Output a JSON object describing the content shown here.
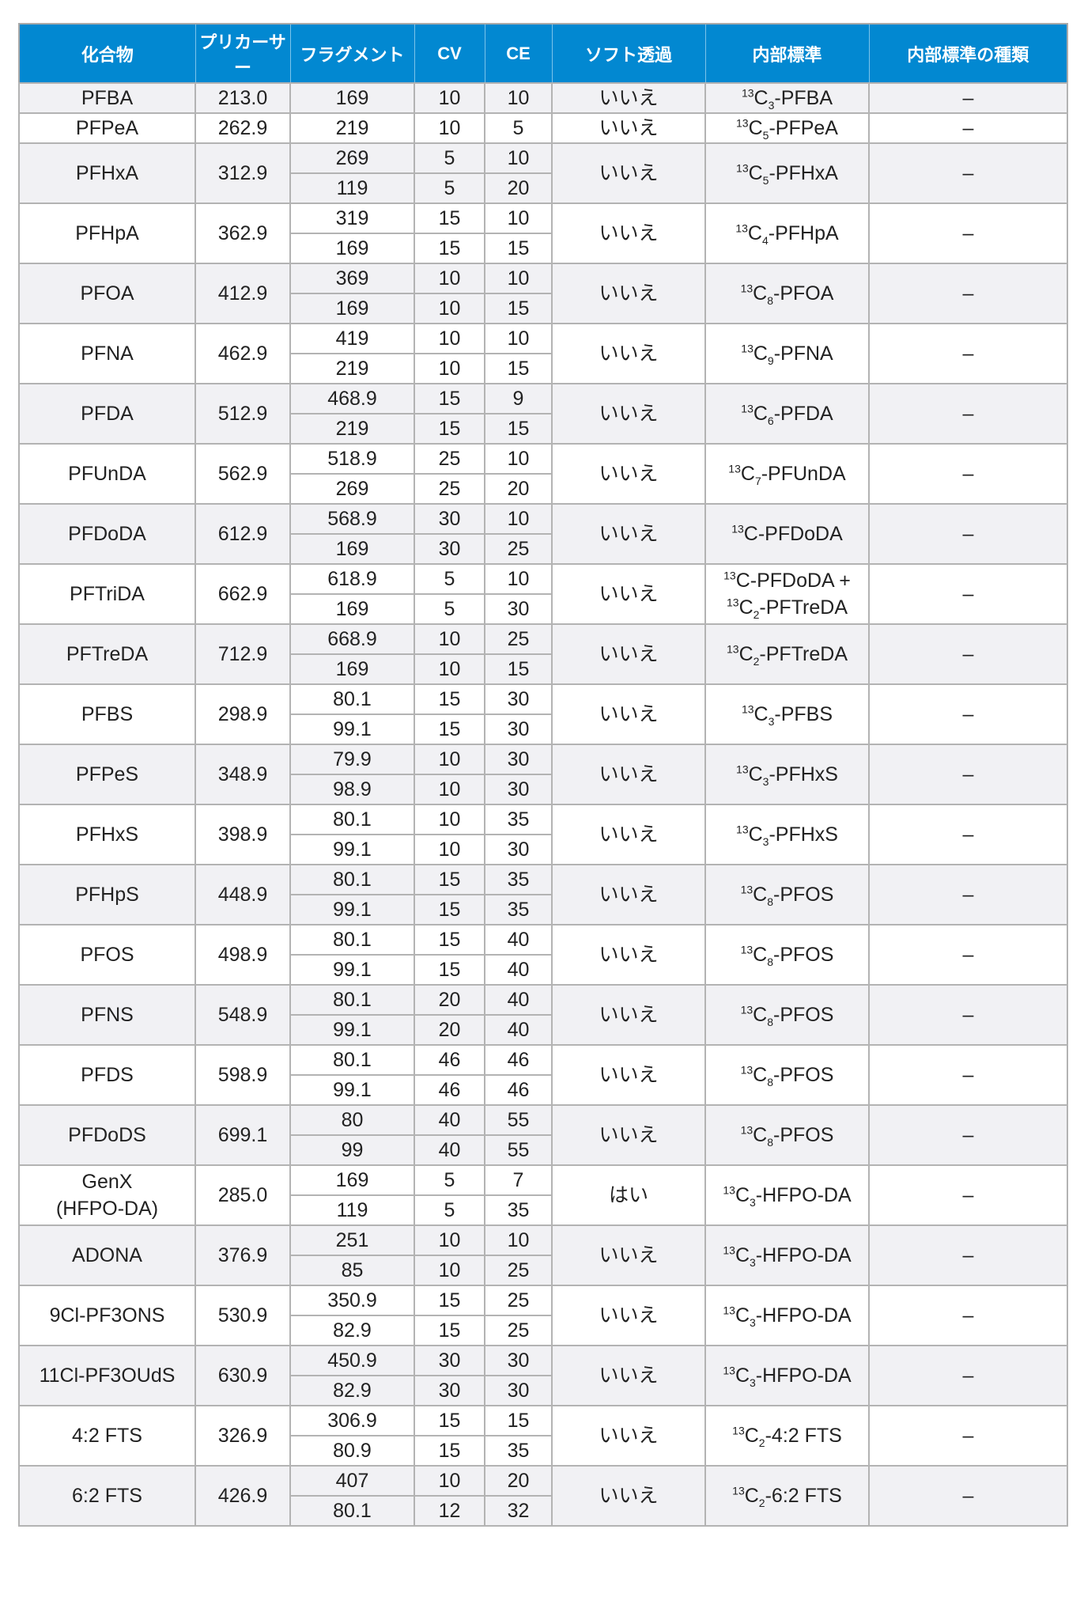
{
  "headers": [
    "化合物",
    "プリカーサー",
    "フラグメント",
    "CV",
    "CE",
    "ソフト透過",
    "内部標準",
    "内部標準の種類"
  ],
  "rows": [
    {
      "compound": "PFBA",
      "precursor": "213.0",
      "transitions": [
        {
          "fragment": "169",
          "cv": "10",
          "ce": "10"
        }
      ],
      "soft": "いいえ",
      "is": [
        {
          "iso": "13",
          "el": "C",
          "n": "3",
          "name": "-PFBA"
        }
      ],
      "is_type": "–"
    },
    {
      "compound": "PFPeA",
      "precursor": "262.9",
      "transitions": [
        {
          "fragment": "219",
          "cv": "10",
          "ce": "5"
        }
      ],
      "soft": "いいえ",
      "is": [
        {
          "iso": "13",
          "el": "C",
          "n": "5",
          "name": "-PFPeA"
        }
      ],
      "is_type": "–"
    },
    {
      "compound": "PFHxA",
      "precursor": "312.9",
      "transitions": [
        {
          "fragment": "269",
          "cv": "5",
          "ce": "10"
        },
        {
          "fragment": "119",
          "cv": "5",
          "ce": "20"
        }
      ],
      "soft": "いいえ",
      "is": [
        {
          "iso": "13",
          "el": "C",
          "n": "5",
          "name": "-PFHxA"
        }
      ],
      "is_type": "–"
    },
    {
      "compound": "PFHpA",
      "precursor": "362.9",
      "transitions": [
        {
          "fragment": "319",
          "cv": "15",
          "ce": "10"
        },
        {
          "fragment": "169",
          "cv": "15",
          "ce": "15"
        }
      ],
      "soft": "いいえ",
      "is": [
        {
          "iso": "13",
          "el": "C",
          "n": "4",
          "name": "-PFHpA"
        }
      ],
      "is_type": "–"
    },
    {
      "compound": "PFOA",
      "precursor": "412.9",
      "transitions": [
        {
          "fragment": "369",
          "cv": "10",
          "ce": "10"
        },
        {
          "fragment": "169",
          "cv": "10",
          "ce": "15"
        }
      ],
      "soft": "いいえ",
      "is": [
        {
          "iso": "13",
          "el": "C",
          "n": "8",
          "name": "-PFOA"
        }
      ],
      "is_type": "–"
    },
    {
      "compound": "PFNA",
      "precursor": "462.9",
      "transitions": [
        {
          "fragment": "419",
          "cv": "10",
          "ce": "10"
        },
        {
          "fragment": "219",
          "cv": "10",
          "ce": "15"
        }
      ],
      "soft": "いいえ",
      "is": [
        {
          "iso": "13",
          "el": "C",
          "n": "9",
          "name": "-PFNA"
        }
      ],
      "is_type": "–"
    },
    {
      "compound": "PFDA",
      "precursor": "512.9",
      "transitions": [
        {
          "fragment": "468.9",
          "cv": "15",
          "ce": "9"
        },
        {
          "fragment": "219",
          "cv": "15",
          "ce": "15"
        }
      ],
      "soft": "いいえ",
      "is": [
        {
          "iso": "13",
          "el": "C",
          "n": "6",
          "name": "-PFDA"
        }
      ],
      "is_type": "–"
    },
    {
      "compound": "PFUnDA",
      "precursor": "562.9",
      "transitions": [
        {
          "fragment": "518.9",
          "cv": "25",
          "ce": "10"
        },
        {
          "fragment": "269",
          "cv": "25",
          "ce": "20"
        }
      ],
      "soft": "いいえ",
      "is": [
        {
          "iso": "13",
          "el": "C",
          "n": "7",
          "name": "-PFUnDA"
        }
      ],
      "is_type": "–"
    },
    {
      "compound": "PFDoDA",
      "precursor": "612.9",
      "transitions": [
        {
          "fragment": "568.9",
          "cv": "30",
          "ce": "10"
        },
        {
          "fragment": "169",
          "cv": "30",
          "ce": "25"
        }
      ],
      "soft": "いいえ",
      "is": [
        {
          "iso": "13",
          "el": "C",
          "n": "",
          "name": "-PFDoDA"
        }
      ],
      "is_type": "–"
    },
    {
      "compound": "PFTriDA",
      "precursor": "662.9",
      "transitions": [
        {
          "fragment": "618.9",
          "cv": "5",
          "ce": "10"
        },
        {
          "fragment": "169",
          "cv": "5",
          "ce": "30"
        }
      ],
      "soft": "いいえ",
      "is": [
        {
          "iso": "13",
          "el": "C",
          "n": "",
          "name": "-PFDoDA +"
        },
        {
          "iso": "13",
          "el": "C",
          "n": "2",
          "name": "-PFTreDA"
        }
      ],
      "is_type": "–"
    },
    {
      "compound": "PFTreDA",
      "precursor": "712.9",
      "transitions": [
        {
          "fragment": "668.9",
          "cv": "10",
          "ce": "25"
        },
        {
          "fragment": "169",
          "cv": "10",
          "ce": "15"
        }
      ],
      "soft": "いいえ",
      "is": [
        {
          "iso": "13",
          "el": "C",
          "n": "2",
          "name": "-PFTreDA"
        }
      ],
      "is_type": "–"
    },
    {
      "compound": "PFBS",
      "precursor": "298.9",
      "transitions": [
        {
          "fragment": "80.1",
          "cv": "15",
          "ce": "30"
        },
        {
          "fragment": "99.1",
          "cv": "15",
          "ce": "30"
        }
      ],
      "soft": "いいえ",
      "is": [
        {
          "iso": "13",
          "el": "C",
          "n": "3",
          "name": "-PFBS"
        }
      ],
      "is_type": "–"
    },
    {
      "compound": "PFPeS",
      "precursor": "348.9",
      "transitions": [
        {
          "fragment": "79.9",
          "cv": "10",
          "ce": "30"
        },
        {
          "fragment": "98.9",
          "cv": "10",
          "ce": "30"
        }
      ],
      "soft": "いいえ",
      "is": [
        {
          "iso": "13",
          "el": "C",
          "n": "3",
          "name": "-PFHxS"
        }
      ],
      "is_type": "–"
    },
    {
      "compound": "PFHxS",
      "precursor": "398.9",
      "transitions": [
        {
          "fragment": "80.1",
          "cv": "10",
          "ce": "35"
        },
        {
          "fragment": "99.1",
          "cv": "10",
          "ce": "30"
        }
      ],
      "soft": "いいえ",
      "is": [
        {
          "iso": "13",
          "el": "C",
          "n": "3",
          "name": "-PFHxS"
        }
      ],
      "is_type": "–"
    },
    {
      "compound": "PFHpS",
      "precursor": "448.9",
      "transitions": [
        {
          "fragment": "80.1",
          "cv": "15",
          "ce": "35"
        },
        {
          "fragment": "99.1",
          "cv": "15",
          "ce": "35"
        }
      ],
      "soft": "いいえ",
      "is": [
        {
          "iso": "13",
          "el": "C",
          "n": "8",
          "name": "-PFOS"
        }
      ],
      "is_type": "–"
    },
    {
      "compound": "PFOS",
      "precursor": "498.9",
      "transitions": [
        {
          "fragment": "80.1",
          "cv": "15",
          "ce": "40"
        },
        {
          "fragment": "99.1",
          "cv": "15",
          "ce": "40"
        }
      ],
      "soft": "いいえ",
      "is": [
        {
          "iso": "13",
          "el": "C",
          "n": "8",
          "name": "-PFOS"
        }
      ],
      "is_type": "–"
    },
    {
      "compound": "PFNS",
      "precursor": "548.9",
      "transitions": [
        {
          "fragment": "80.1",
          "cv": "20",
          "ce": "40"
        },
        {
          "fragment": "99.1",
          "cv": "20",
          "ce": "40"
        }
      ],
      "soft": "いいえ",
      "is": [
        {
          "iso": "13",
          "el": "C",
          "n": "8",
          "name": "-PFOS"
        }
      ],
      "is_type": "–"
    },
    {
      "compound": "PFDS",
      "precursor": "598.9",
      "transitions": [
        {
          "fragment": "80.1",
          "cv": "46",
          "ce": "46"
        },
        {
          "fragment": "99.1",
          "cv": "46",
          "ce": "46"
        }
      ],
      "soft": "いいえ",
      "is": [
        {
          "iso": "13",
          "el": "C",
          "n": "8",
          "name": "-PFOS"
        }
      ],
      "is_type": "–"
    },
    {
      "compound": "PFDoDS",
      "precursor": "699.1",
      "transitions": [
        {
          "fragment": "80",
          "cv": "40",
          "ce": "55"
        },
        {
          "fragment": "99",
          "cv": "40",
          "ce": "55"
        }
      ],
      "soft": "いいえ",
      "is": [
        {
          "iso": "13",
          "el": "C",
          "n": "8",
          "name": "-PFOS"
        }
      ],
      "is_type": "–"
    },
    {
      "compound": "GenX\n(HFPO-DA)",
      "precursor": "285.0",
      "transitions": [
        {
          "fragment": "169",
          "cv": "5",
          "ce": "7"
        },
        {
          "fragment": "119",
          "cv": "5",
          "ce": "35"
        }
      ],
      "soft": "はい",
      "is": [
        {
          "iso": "13",
          "el": "C",
          "n": "3",
          "name": "-HFPO-DA"
        }
      ],
      "is_type": "–"
    },
    {
      "compound": "ADONA",
      "precursor": "376.9",
      "transitions": [
        {
          "fragment": "251",
          "cv": "10",
          "ce": "10"
        },
        {
          "fragment": "85",
          "cv": "10",
          "ce": "25"
        }
      ],
      "soft": "いいえ",
      "is": [
        {
          "iso": "13",
          "el": "C",
          "n": "3",
          "name": "-HFPO-DA"
        }
      ],
      "is_type": "–"
    },
    {
      "compound": "9Cl-PF3ONS",
      "precursor": "530.9",
      "transitions": [
        {
          "fragment": "350.9",
          "cv": "15",
          "ce": "25"
        },
        {
          "fragment": "82.9",
          "cv": "15",
          "ce": "25"
        }
      ],
      "soft": "いいえ",
      "is": [
        {
          "iso": "13",
          "el": "C",
          "n": "3",
          "name": "-HFPO-DA"
        }
      ],
      "is_type": "–"
    },
    {
      "compound": "11Cl-PF3OUdS",
      "precursor": "630.9",
      "transitions": [
        {
          "fragment": "450.9",
          "cv": "30",
          "ce": "30"
        },
        {
          "fragment": "82.9",
          "cv": "30",
          "ce": "30"
        }
      ],
      "soft": "いいえ",
      "is": [
        {
          "iso": "13",
          "el": "C",
          "n": "3",
          "name": "-HFPO-DA"
        }
      ],
      "is_type": "–"
    },
    {
      "compound": "4:2 FTS",
      "precursor": "326.9",
      "transitions": [
        {
          "fragment": "306.9",
          "cv": "15",
          "ce": "15"
        },
        {
          "fragment": "80.9",
          "cv": "15",
          "ce": "35"
        }
      ],
      "soft": "いいえ",
      "is": [
        {
          "iso": "13",
          "el": "C",
          "n": "2",
          "name": "-4:2 FTS"
        }
      ],
      "is_type": "–"
    },
    {
      "compound": "6:2 FTS",
      "precursor": "426.9",
      "transitions": [
        {
          "fragment": "407",
          "cv": "10",
          "ce": "20"
        },
        {
          "fragment": "80.1",
          "cv": "12",
          "ce": "32"
        }
      ],
      "soft": "いいえ",
      "is": [
        {
          "iso": "13",
          "el": "C",
          "n": "2",
          "name": "-6:2 FTS"
        }
      ],
      "is_type": "–"
    }
  ]
}
